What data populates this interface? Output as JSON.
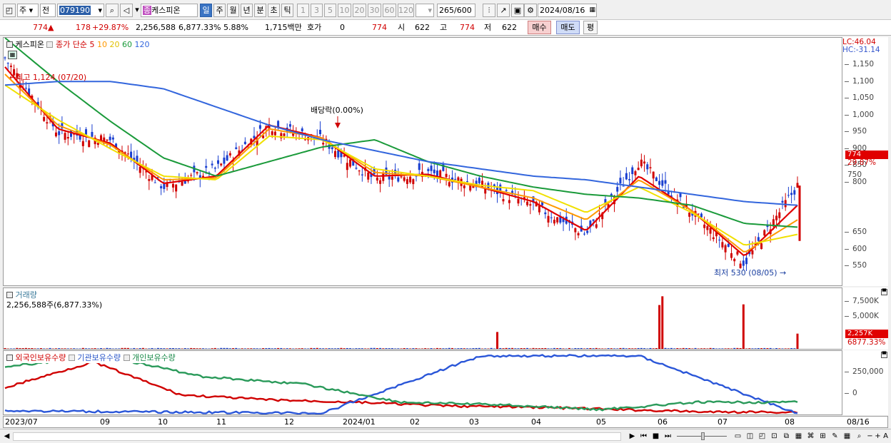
{
  "toolbar": {
    "mode1": "주",
    "mode2": "전",
    "code": "079190",
    "name": "케스피온",
    "periods": [
      "일",
      "주",
      "월",
      "년",
      "분",
      "초",
      "틱"
    ],
    "active_period": "일",
    "nums": [
      "1",
      "3",
      "5",
      "10",
      "20",
      "30",
      "60",
      "120"
    ],
    "count": "265",
    "total": "/600",
    "date": "2024/08/16",
    "badge": "종"
  },
  "quote": {
    "price": "774",
    "arrow": "▲",
    "change": "178",
    "pct": "+29.87%",
    "volume": "2,256,588",
    "turnover": "6,877.33%",
    "pct2": "5.88%",
    "amount": "1,715백만",
    "hoga_label": "호가",
    "hoga": "0",
    "h_price": "774",
    "open_label": "시",
    "open": "622",
    "high_label": "고",
    "high": "774",
    "low_label": "저",
    "low": "622",
    "buy": "매수",
    "sell": "매도",
    "eval": "평"
  },
  "price_panel": {
    "legend_name": "케스피온",
    "legend_ma": "종가 단순",
    "ma_periods": [
      "5",
      "10",
      "20",
      "60",
      "120"
    ],
    "ma_colors": [
      "#e00000",
      "#ff9900",
      "#f0e000",
      "#1a9a3a",
      "#3366dd"
    ],
    "max_label": "최고 1,124 (07/20)",
    "min_label": "최저 530 (08/05)",
    "div_label": "배당락(0.00%)",
    "lc": "LC:46.04",
    "hc": "HC:-31.14",
    "price_tag": "774",
    "pct_tag": "29.87%"
  },
  "price_axis": [
    "1,150",
    "1,100",
    "1,050",
    "1,000",
    "950",
    "900",
    "850",
    "800",
    "750",
    "700",
    "650",
    "600",
    "550"
  ],
  "volume_panel": {
    "title": "거래량",
    "info": "2,256,588주(6,877.33%)",
    "tag": "2,257K",
    "tag2": "6877.33%"
  },
  "volume_axis": [
    "7,500K",
    "5,000K"
  ],
  "holdings_panel": {
    "s1": "외국인보유수량",
    "s2": "기관보유수량",
    "s3": "개인보유수량"
  },
  "holdings_axis": [
    "250,000",
    "0"
  ],
  "x_axis": [
    "2023/07",
    "09",
    "10",
    "11",
    "12",
    "2024/01",
    "02",
    "03",
    "04",
    "05",
    "06",
    "07",
    "08",
    "08/16"
  ],
  "chart_data": [
    {
      "type": "candlestick",
      "title": "케스피온",
      "x_range": [
        "2023/07",
        "2024/08/16"
      ],
      "ylim": [
        500,
        1180
      ],
      "series": [
        {
          "name": "종가",
          "x": [
            "2023/07/20",
            "2023/08",
            "2023/09",
            "2023/10",
            "2023/11",
            "2023/12",
            "2024/01",
            "2024/02",
            "2024/03",
            "2024/04",
            "2024/05",
            "2024/06/03",
            "2024/06",
            "2024/07",
            "2024/08/05",
            "2024/08/16"
          ],
          "values": [
            1124,
            920,
            900,
            770,
            820,
            940,
            900,
            790,
            810,
            775,
            720,
            640,
            840,
            700,
            560,
            774
          ]
        },
        {
          "name": "5",
          "values": [
            1100,
            930,
            890,
            780,
            800,
            940,
            905,
            800,
            805,
            770,
            730,
            650,
            800,
            705,
            580,
            720
          ]
        },
        {
          "name": "10",
          "values": [
            1080,
            940,
            885,
            790,
            795,
            930,
            905,
            810,
            800,
            770,
            740,
            680,
            790,
            705,
            590,
            680
          ]
        },
        {
          "name": "20",
          "values": [
            1050,
            955,
            875,
            800,
            790,
            910,
            900,
            820,
            800,
            775,
            760,
            700,
            770,
            700,
            610,
            640
          ]
        },
        {
          "name": "60",
          "values": [
            1180,
            1060,
            950,
            850,
            800,
            840,
            880,
            900,
            840,
            800,
            770,
            750,
            740,
            720,
            670,
            660
          ]
        },
        {
          "name": "120",
          "values": [
            1050,
            1060,
            1060,
            1040,
            990,
            940,
            900,
            870,
            840,
            820,
            800,
            790,
            770,
            750,
            730,
            720
          ]
        }
      ]
    },
    {
      "type": "bar",
      "title": "거래량",
      "ylim": [
        0,
        9000000
      ],
      "x": [
        "2023/09",
        "2024/06/03",
        "2024/06/05",
        "2024/08",
        "2024/08/16"
      ],
      "values": [
        2500000,
        6500000,
        7800000,
        6600000,
        2256588
      ]
    },
    {
      "type": "line",
      "title": "외국인보유수량/기관보유수량/개인보유수량",
      "ylim": [
        -100000,
        420000
      ],
      "series": [
        {
          "name": "외국인보유수량",
          "x": [
            "2023/07",
            "2023/08",
            "2023/09",
            "2023/10",
            "2023/12",
            "2024/02",
            "2024/04",
            "2024/05",
            "2024/06",
            "2024/08"
          ],
          "values": [
            120000,
            330000,
            60000,
            20000,
            0,
            -30000,
            -40000,
            -60000,
            -80000,
            -80000
          ]
        },
        {
          "name": "기관보유수량",
          "x": [
            "2023/07",
            "2023/09",
            "2024/05",
            "2024/06",
            "2024/07",
            "2024/08"
          ],
          "values": [
            -70000,
            -80000,
            -90000,
            380000,
            380000,
            -90000
          ]
        },
        {
          "name": "개인보유수량",
          "x": [
            "2023/07",
            "2023/09",
            "2023/11",
            "2024/01",
            "2024/03",
            "2024/05",
            "2024/06",
            "2024/07",
            "2024/08"
          ],
          "values": [
            290000,
            380000,
            210000,
            150000,
            0,
            -20000,
            -60000,
            0,
            0
          ]
        }
      ]
    }
  ]
}
